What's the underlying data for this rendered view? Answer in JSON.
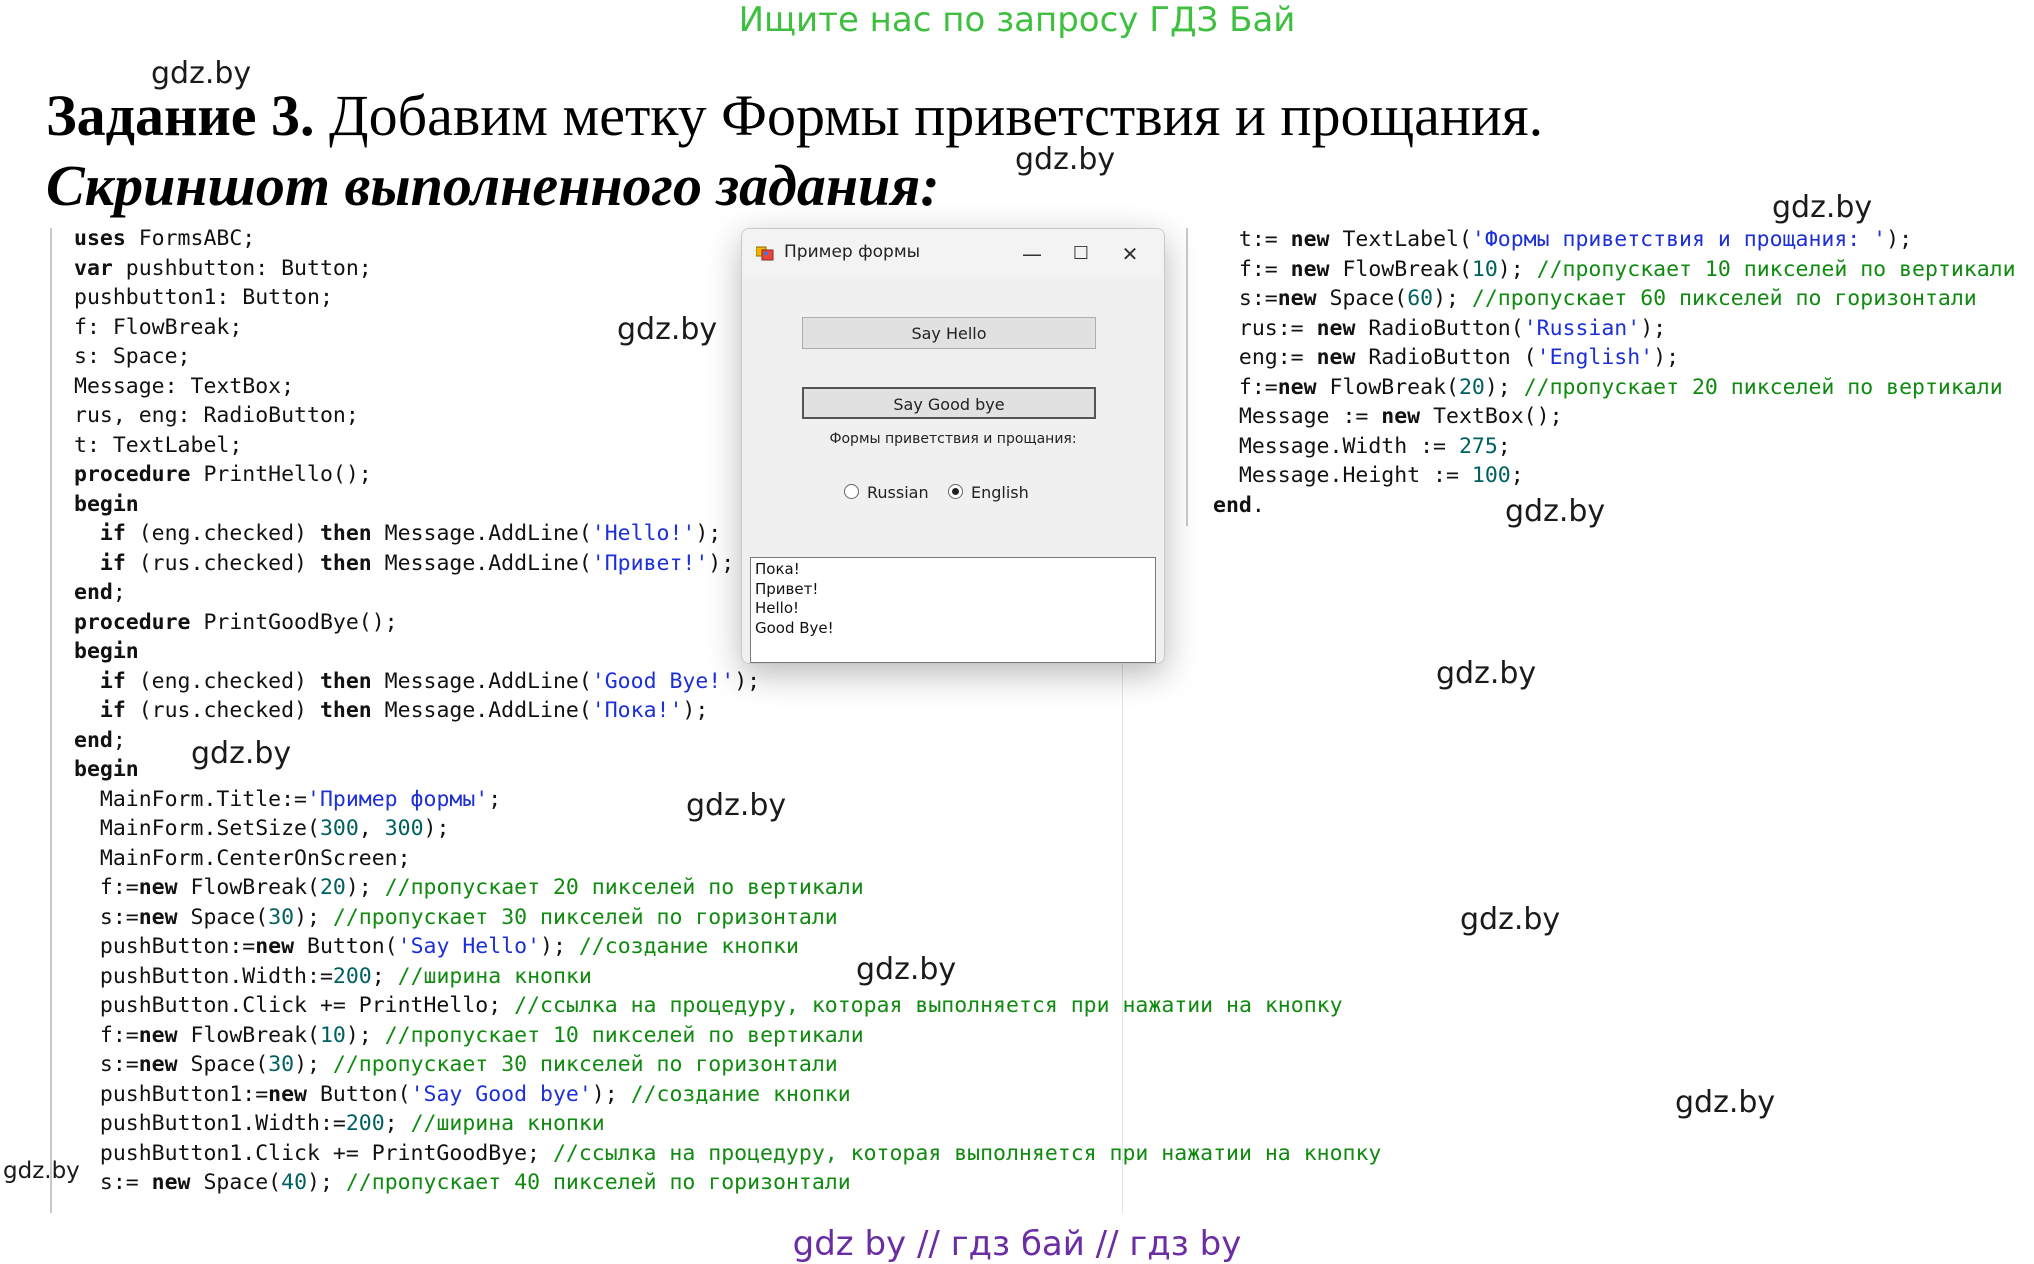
{
  "banner": "Ищите нас по запросу ГДЗ Бай",
  "heading": {
    "task_bold": "Задание 3.",
    "task_text": " Добавим метку Формы приветствия и прощания.",
    "subtitle": "Скриншот выполненного задания:"
  },
  "watermark": "gdz.by",
  "footer": "gdz by  //  гдз бай  //  гдз by",
  "code_left": [
    [
      [
        "uses",
        "kw"
      ],
      [
        " FormsABC;",
        ""
      ]
    ],
    [
      [
        "var",
        "kw"
      ],
      [
        " pushbutton: Button;",
        ""
      ]
    ],
    [
      [
        "pushbutton1: Button;",
        ""
      ]
    ],
    [
      [
        "f: FlowBreak;",
        ""
      ]
    ],
    [
      [
        "s: Space;",
        ""
      ]
    ],
    [
      [
        "Message: TextBox;",
        ""
      ]
    ],
    [
      [
        "rus, eng: RadioButton;",
        ""
      ]
    ],
    [
      [
        "t: TextLabel;",
        ""
      ]
    ],
    [
      [
        "procedure",
        "kw"
      ],
      [
        " PrintHello();",
        ""
      ]
    ],
    [
      [
        "begin",
        "kw"
      ]
    ],
    [
      [
        "  ",
        ""
      ],
      [
        "if",
        "kw"
      ],
      [
        " (eng.checked) ",
        ""
      ],
      [
        "then",
        "kw"
      ],
      [
        " Message.AddLine(",
        ""
      ],
      [
        "'Hello!'",
        "str"
      ],
      [
        ");",
        ""
      ]
    ],
    [
      [
        "  ",
        ""
      ],
      [
        "if",
        "kw"
      ],
      [
        " (rus.checked) ",
        ""
      ],
      [
        "then",
        "kw"
      ],
      [
        " Message.AddLine(",
        ""
      ],
      [
        "'Привет!'",
        "str"
      ],
      [
        ");",
        ""
      ]
    ],
    [
      [
        "end",
        "kw"
      ],
      [
        ";",
        ""
      ]
    ],
    [
      [
        "procedure",
        "kw"
      ],
      [
        " PrintGoodBye();",
        ""
      ]
    ],
    [
      [
        "begin",
        "kw"
      ]
    ],
    [
      [
        "  ",
        ""
      ],
      [
        "if",
        "kw"
      ],
      [
        " (eng.checked) ",
        ""
      ],
      [
        "then",
        "kw"
      ],
      [
        " Message.AddLine(",
        ""
      ],
      [
        "'Good Bye!'",
        "str"
      ],
      [
        ");",
        ""
      ]
    ],
    [
      [
        "  ",
        ""
      ],
      [
        "if",
        "kw"
      ],
      [
        " (rus.checked) ",
        ""
      ],
      [
        "then",
        "kw"
      ],
      [
        " Message.AddLine(",
        ""
      ],
      [
        "'Пока!'",
        "str"
      ],
      [
        ");",
        ""
      ]
    ],
    [
      [
        "end",
        "kw"
      ],
      [
        ";",
        ""
      ]
    ],
    [
      [
        "begin",
        "kw"
      ]
    ],
    [
      [
        "  MainForm.Title:=",
        ""
      ],
      [
        "'Пример формы'",
        "str"
      ],
      [
        ";",
        ""
      ]
    ],
    [
      [
        "  MainForm.SetSize(",
        ""
      ],
      [
        "300",
        "num"
      ],
      [
        ", ",
        ""
      ],
      [
        "300",
        "num"
      ],
      [
        ");",
        ""
      ]
    ],
    [
      [
        "  MainForm.CenterOnScreen;",
        ""
      ]
    ],
    [
      [
        "  f:=",
        ""
      ],
      [
        "new",
        "kw"
      ],
      [
        " FlowBreak(",
        ""
      ],
      [
        "20",
        "num"
      ],
      [
        "); ",
        ""
      ],
      [
        "//пропускает 20 пикселей по вертикали",
        "cm"
      ]
    ],
    [
      [
        "  s:=",
        ""
      ],
      [
        "new",
        "kw"
      ],
      [
        " Space(",
        ""
      ],
      [
        "30",
        "num"
      ],
      [
        "); ",
        ""
      ],
      [
        "//пропускает 30 пикселей по горизонтали",
        "cm"
      ]
    ],
    [
      [
        "  pushButton:=",
        ""
      ],
      [
        "new",
        "kw"
      ],
      [
        " Button(",
        ""
      ],
      [
        "'Say Hello'",
        "str"
      ],
      [
        "); ",
        ""
      ],
      [
        "//создание кнопки",
        "cm"
      ]
    ],
    [
      [
        "  pushButton.Width:=",
        ""
      ],
      [
        "200",
        "num"
      ],
      [
        "; ",
        ""
      ],
      [
        "//ширина кнопки",
        "cm"
      ]
    ],
    [
      [
        "  pushButton.Click += PrintHello; ",
        ""
      ],
      [
        "//ссылка на процедуру, которая выполняется при нажатии на кнопку",
        "cm"
      ]
    ],
    [
      [
        "  f:=",
        ""
      ],
      [
        "new",
        "kw"
      ],
      [
        " FlowBreak(",
        ""
      ],
      [
        "10",
        "num"
      ],
      [
        "); ",
        ""
      ],
      [
        "//пропускает 10 пикселей по вертикали",
        "cm"
      ]
    ],
    [
      [
        "  s:=",
        ""
      ],
      [
        "new",
        "kw"
      ],
      [
        " Space(",
        ""
      ],
      [
        "30",
        "num"
      ],
      [
        "); ",
        ""
      ],
      [
        "//пропускает 30 пикселей по горизонтали",
        "cm"
      ]
    ],
    [
      [
        "  pushButton1:=",
        ""
      ],
      [
        "new",
        "kw"
      ],
      [
        " Button(",
        ""
      ],
      [
        "'Say Good bye'",
        "str"
      ],
      [
        "); ",
        ""
      ],
      [
        "//создание кнопки",
        "cm"
      ]
    ],
    [
      [
        "  pushButton1.Width:=",
        ""
      ],
      [
        "200",
        "num"
      ],
      [
        "; ",
        ""
      ],
      [
        "//ширина кнопки",
        "cm"
      ]
    ],
    [
      [
        "  pushButton1.Click += PrintGoodBye; ",
        ""
      ],
      [
        "//ссылка на процедуру, которая выполняется при нажатии на кнопку",
        "cm"
      ]
    ],
    [
      [
        "  s:= ",
        ""
      ],
      [
        "new",
        "kw"
      ],
      [
        " Space(",
        ""
      ],
      [
        "40",
        "num"
      ],
      [
        "); ",
        ""
      ],
      [
        "//пропускает 40 пикселей по горизонтали",
        "cm"
      ]
    ]
  ],
  "code_right": [
    [
      [
        "  t:= ",
        ""
      ],
      [
        "new",
        "kw"
      ],
      [
        " TextLabel(",
        ""
      ],
      [
        "'Формы приветствия и прощания: '",
        "str"
      ],
      [
        ");",
        ""
      ]
    ],
    [
      [
        "  f:= ",
        ""
      ],
      [
        "new",
        "kw"
      ],
      [
        " FlowBreak(",
        ""
      ],
      [
        "10",
        "num"
      ],
      [
        "); ",
        ""
      ],
      [
        "//пропускает 10 пикселей по вертикали",
        "cm"
      ]
    ],
    [
      [
        "  s:=",
        ""
      ],
      [
        "new",
        "kw"
      ],
      [
        " Space(",
        ""
      ],
      [
        "60",
        "num"
      ],
      [
        "); ",
        ""
      ],
      [
        "//пропускает 60 пикселей по горизонтали",
        "cm"
      ]
    ],
    [
      [
        "  rus:= ",
        ""
      ],
      [
        "new",
        "kw"
      ],
      [
        " RadioButton(",
        ""
      ],
      [
        "'Russian'",
        "str"
      ],
      [
        ");",
        ""
      ]
    ],
    [
      [
        "  eng:= ",
        ""
      ],
      [
        "new",
        "kw"
      ],
      [
        " RadioButton (",
        ""
      ],
      [
        "'English'",
        "str"
      ],
      [
        ");",
        ""
      ]
    ],
    [
      [
        "  f:=",
        ""
      ],
      [
        "new",
        "kw"
      ],
      [
        " FlowBreak(",
        ""
      ],
      [
        "20",
        "num"
      ],
      [
        "); ",
        ""
      ],
      [
        "//пропускает 20 пикселей по вертикали",
        "cm"
      ]
    ],
    [
      [
        "  Message := ",
        ""
      ],
      [
        "new",
        "kw"
      ],
      [
        " TextBox();",
        ""
      ]
    ],
    [
      [
        "  Message.Width := ",
        ""
      ],
      [
        "275",
        "num"
      ],
      [
        ";",
        ""
      ]
    ],
    [
      [
        "  Message.Height := ",
        ""
      ],
      [
        "100",
        "num"
      ],
      [
        ";",
        ""
      ]
    ],
    [
      [
        "end",
        "kw"
      ],
      [
        ".",
        ""
      ]
    ]
  ],
  "window": {
    "title": "Пример формы",
    "minimize": "—",
    "maximize": "☐",
    "close": "✕",
    "button_hello": "Say Hello",
    "button_goodbye": "Say Good bye",
    "label": "Формы приветствия и прощания:",
    "radio_russian": "Russian",
    "radio_english": "English",
    "radio_selected": "English",
    "textbox_lines": [
      "Пока!",
      "Привет!",
      "Hello!",
      "Good Bye!"
    ]
  }
}
